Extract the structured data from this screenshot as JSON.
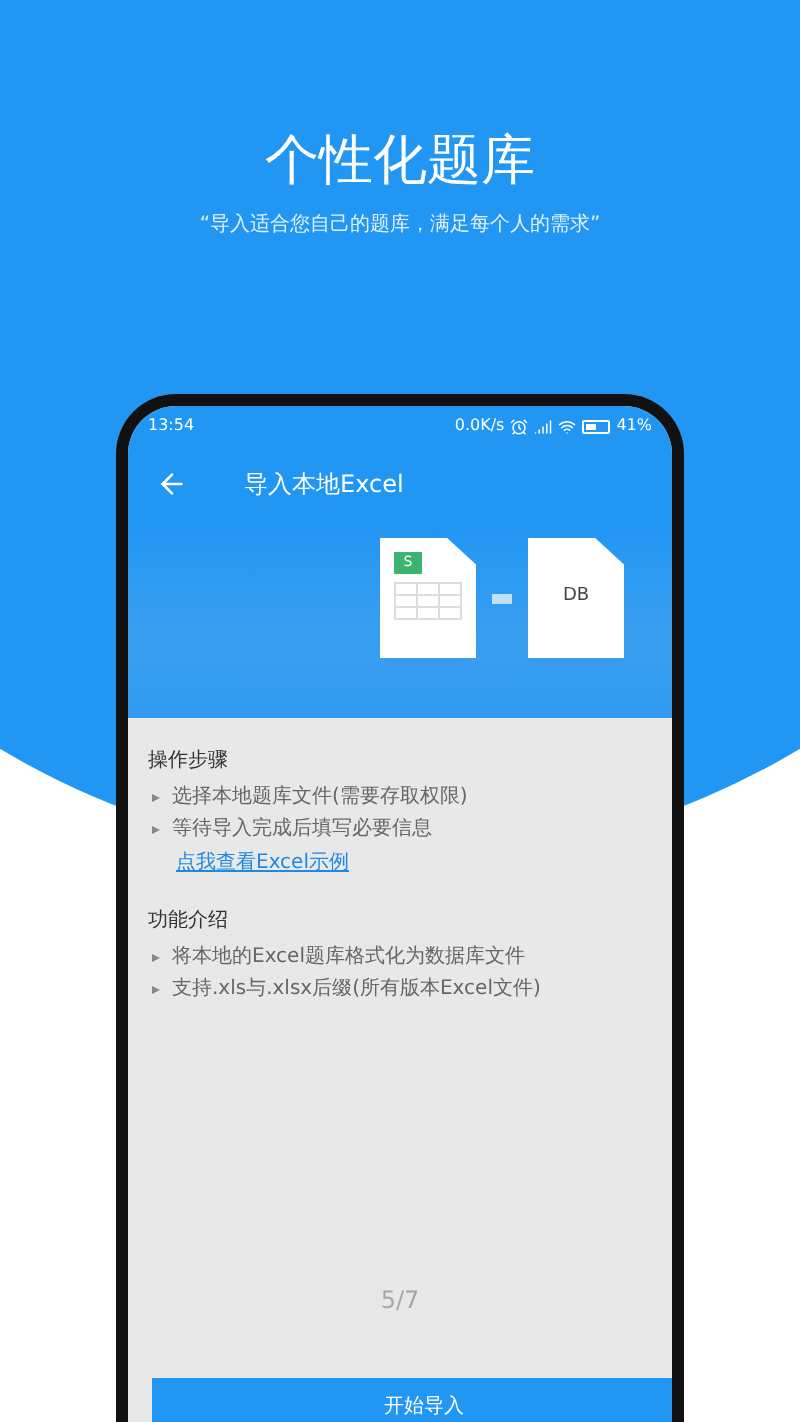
{
  "headline": "个性化题库",
  "subtitle": "“导入适合您自己的题库，满足每个人的需求”",
  "status_bar": {
    "time": "13:54",
    "speed": "0.0K/s",
    "battery": "41%"
  },
  "header": {
    "title": "导入本地Excel"
  },
  "banner": {
    "source_badge": "S",
    "target_label": "DB"
  },
  "steps": {
    "title": "操作步骤",
    "items": [
      "选择本地题库文件(需要存取权限)",
      "等待导入完成后填写必要信息"
    ],
    "link": "点我查看Excel示例"
  },
  "features": {
    "title": "功能介绍",
    "items": [
      "将本地的Excel题库格式化为数据库文件",
      "支持.xls与.xlsx后缀(所有版本Excel文件)"
    ]
  },
  "page_indicator": "5/7",
  "start_button": "开始导入"
}
